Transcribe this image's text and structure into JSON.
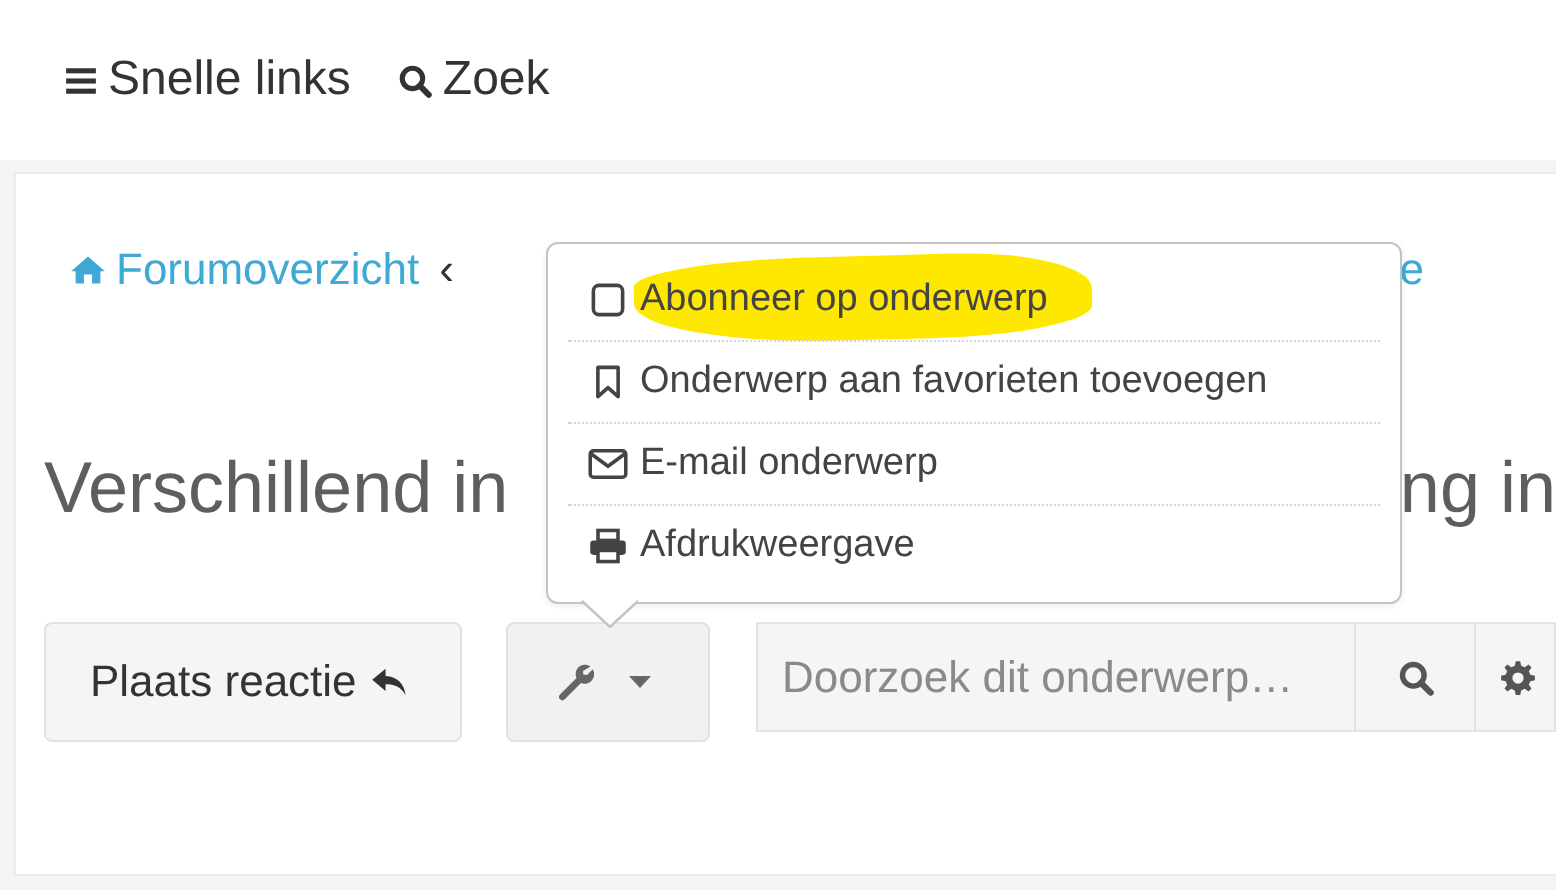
{
  "header": {
    "links": [
      {
        "label": "Snelle links"
      },
      {
        "label": "Zoek"
      }
    ]
  },
  "breadcrumb": {
    "home": "Forumoverzicht",
    "separator": "‹",
    "trailing_fragment": "e"
  },
  "topic_title": {
    "start": "Verschillend in",
    "end": "ng in"
  },
  "actions": {
    "reply_button": "Plaats reactie",
    "tools_button": {
      "expanded": true
    },
    "search": {
      "placeholder": "Doorzoek dit onderwerp…"
    }
  },
  "tools_menu": [
    {
      "label": "Abonneer op onderwerp",
      "highlighted": true
    },
    {
      "label": "Onderwerp aan favorieten toevoegen",
      "highlighted": false
    },
    {
      "label": "E-mail onderwerp",
      "highlighted": false
    },
    {
      "label": "Afdrukweergave",
      "highlighted": false
    }
  ]
}
